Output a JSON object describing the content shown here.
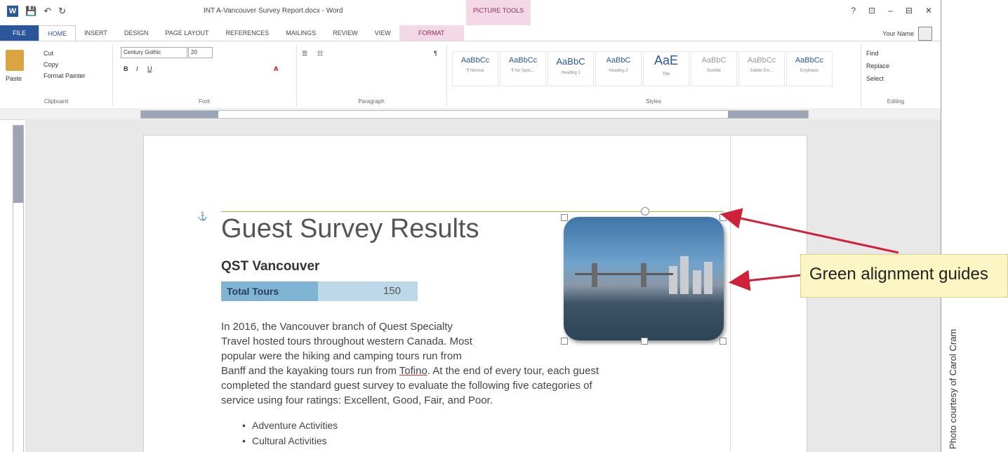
{
  "titlebar": {
    "doc_title": "INT A-Vancouver Survey Report.docx - Word",
    "contextual_group": "PICTURE TOOLS",
    "window_controls": [
      "?",
      "⊡",
      "–",
      "⊟",
      "✕"
    ]
  },
  "tabs": [
    "FILE",
    "HOME",
    "INSERT",
    "DESIGN",
    "PAGE LAYOUT",
    "REFERENCES",
    "MAILINGS",
    "REVIEW",
    "VIEW",
    "FORMAT"
  ],
  "user": {
    "name": "Your Name"
  },
  "ribbon": {
    "clipboard": {
      "paste": "Paste",
      "cut": "Cut",
      "copy": "Copy",
      "format_painter": "Format Painter",
      "label": "Clipboard"
    },
    "font": {
      "family": "Century Gothic",
      "size": "20",
      "label": "Font"
    },
    "paragraph": {
      "label": "Paragraph"
    },
    "styles": {
      "label": "Styles",
      "items": [
        {
          "sample": "AaBbCc",
          "name": "¶ Normal"
        },
        {
          "sample": "AaBbCc",
          "name": "¶ No Spac..."
        },
        {
          "sample": "AaBbC",
          "name": "Heading 1"
        },
        {
          "sample": "AaBbC",
          "name": "Heading 2"
        },
        {
          "sample": "AaE",
          "name": "Title"
        },
        {
          "sample": "AaBbC",
          "name": "Subtitle"
        },
        {
          "sample": "AaBbCc",
          "name": "Subtle Em..."
        },
        {
          "sample": "AaBbCc",
          "name": "Emphasis"
        }
      ]
    },
    "editing": {
      "find": "Find",
      "replace": "Replace",
      "select": "Select",
      "label": "Editing"
    }
  },
  "document": {
    "heading": "Guest Survey Results",
    "subheading": "QST Vancouver",
    "tours_label": "Total Tours",
    "tours_value": "150",
    "paragraph_lines": [
      "In 2016, the Vancouver branch of Quest Specialty",
      "Travel hosted tours throughout western Canada. Most",
      "popular were the hiking and camping tours run from",
      "completed the standard guest survey to evaluate the following five categories of",
      "service using four ratings: Excellent, Good, Fair, and Poor."
    ],
    "line4_before": "Banff and the kayaking tours run from ",
    "line4_spell": "Tofino",
    "line4_after": ". At the end of every tour, each guest",
    "bullets": [
      "Adventure Activities",
      "Cultural Activities"
    ]
  },
  "callout": {
    "text": "Green alignment guides"
  },
  "credit": "Photo courtesy of Carol Cram",
  "colors": {
    "guide": "#8cc63f",
    "arrow": "#d0213b",
    "word_blue": "#2b579a",
    "callout_bg": "#fbf6c4"
  }
}
